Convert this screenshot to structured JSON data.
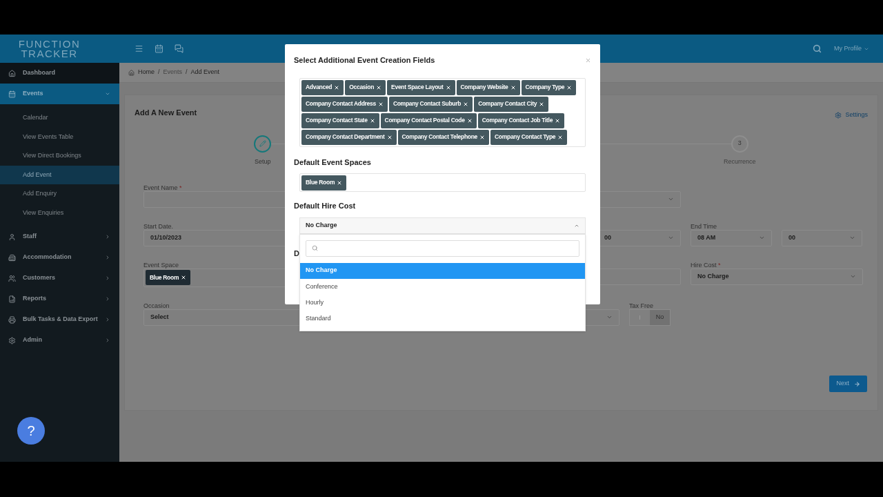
{
  "brand": {
    "line1": "FUNCTION",
    "line2": "TRACKER"
  },
  "topbar": {
    "profile": "My Profile"
  },
  "sidebar": {
    "items": [
      {
        "label": "Dashboard",
        "kind": "link",
        "selected": false
      },
      {
        "label": "Events",
        "kind": "group",
        "expanded": true,
        "selected": true,
        "children": [
          {
            "label": "Calendar",
            "selected": false
          },
          {
            "label": "View Events Table",
            "selected": false
          },
          {
            "label": "View Direct Bookings",
            "selected": false
          },
          {
            "label": "Add Event",
            "selected": true
          },
          {
            "label": "Add Enquiry",
            "selected": false
          },
          {
            "label": "View Enquiries",
            "selected": false
          }
        ]
      },
      {
        "label": "Staff",
        "kind": "group",
        "expanded": false,
        "selected": false
      },
      {
        "label": "Accommodation",
        "kind": "group",
        "expanded": false,
        "selected": false
      },
      {
        "label": "Customers",
        "kind": "group",
        "expanded": false,
        "selected": false
      },
      {
        "label": "Reports",
        "kind": "group",
        "expanded": false,
        "selected": false
      },
      {
        "label": "Bulk Tasks & Data Export",
        "kind": "group",
        "expanded": false,
        "selected": false
      },
      {
        "label": "Admin",
        "kind": "group",
        "expanded": false,
        "selected": false
      }
    ],
    "help": "?"
  },
  "breadcrumb": {
    "separator": "/",
    "items": [
      "Home",
      "Events",
      "Add Event"
    ]
  },
  "page": {
    "title": "Add A New Event",
    "settings": "Settings",
    "steps": [
      {
        "kind": "icon",
        "label": "Setup",
        "selected": true
      },
      {
        "kind": "number",
        "number": "3",
        "label": "Recurrence",
        "selected": false
      }
    ],
    "fields": [
      {
        "kind": "input",
        "label": "Event Name",
        "required_mark": "*"
      },
      {
        "kind": "select"
      },
      {
        "kind": "input",
        "label": "Start Date.",
        "value": "01/10/2023"
      },
      {
        "kind": "select",
        "value": "00"
      },
      {
        "kind": "select",
        "label": "End Time",
        "value": "08 AM"
      },
      {
        "kind": "select",
        "value": "00"
      },
      {
        "kind": "tags",
        "label": "Event Space",
        "tags": [
          "Blue Room"
        ]
      },
      {
        "kind": "input"
      },
      {
        "kind": "select",
        "label": "Hire Cost",
        "required_mark": "*",
        "value": "No Charge"
      },
      {
        "kind": "select",
        "label": "Occasion",
        "value": "Select"
      },
      {
        "kind": "toggle",
        "label": "Tax Free",
        "on": false,
        "off_label": "No"
      }
    ],
    "next": "Next"
  },
  "modal": {
    "title": "Select Additional Event Creation Fields",
    "fields": [
      "Advanced",
      "Occasion",
      "Event Space Layout",
      "Company Website",
      "Company Type",
      "Company Contact Address",
      "Company Contact Suburb",
      "Company Contact City",
      "Company Contact State",
      "Company Contact Postal Code",
      "Company Contact Job Title",
      "Company Contact Department",
      "Company Contact Telephone",
      "Company Contact Type"
    ],
    "event_spaces": {
      "heading": "Default Event Spaces",
      "tags": [
        "Blue Room"
      ]
    },
    "hire_cost": {
      "heading": "Default Hire Cost",
      "value": "No Charge",
      "expanded": true,
      "options": [
        {
          "label": "No Charge",
          "selected": true
        },
        {
          "label": "Conference",
          "selected": false
        },
        {
          "label": "Hourly",
          "selected": false
        },
        {
          "label": "Standard",
          "selected": false
        }
      ]
    },
    "next_heading": "D"
  }
}
